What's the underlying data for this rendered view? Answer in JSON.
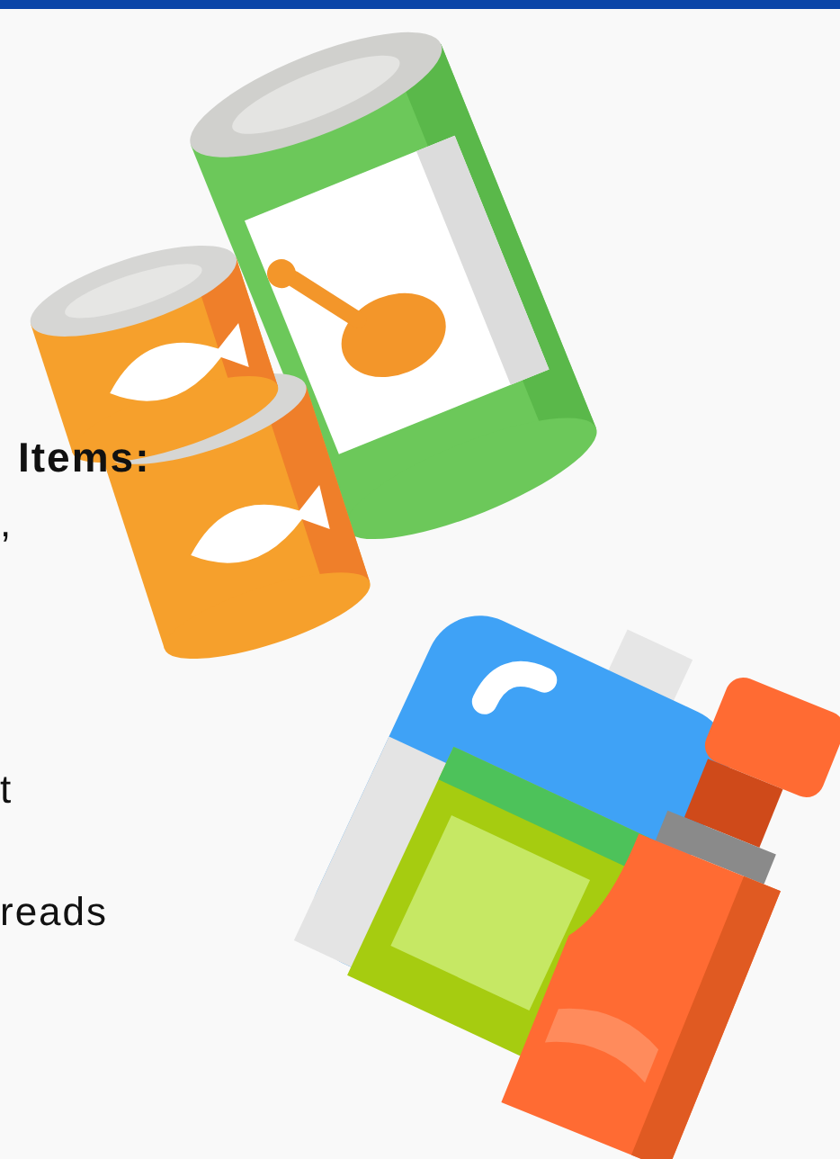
{
  "heading": "Items:",
  "lines": [
    ",",
    "t",
    "reads"
  ]
}
